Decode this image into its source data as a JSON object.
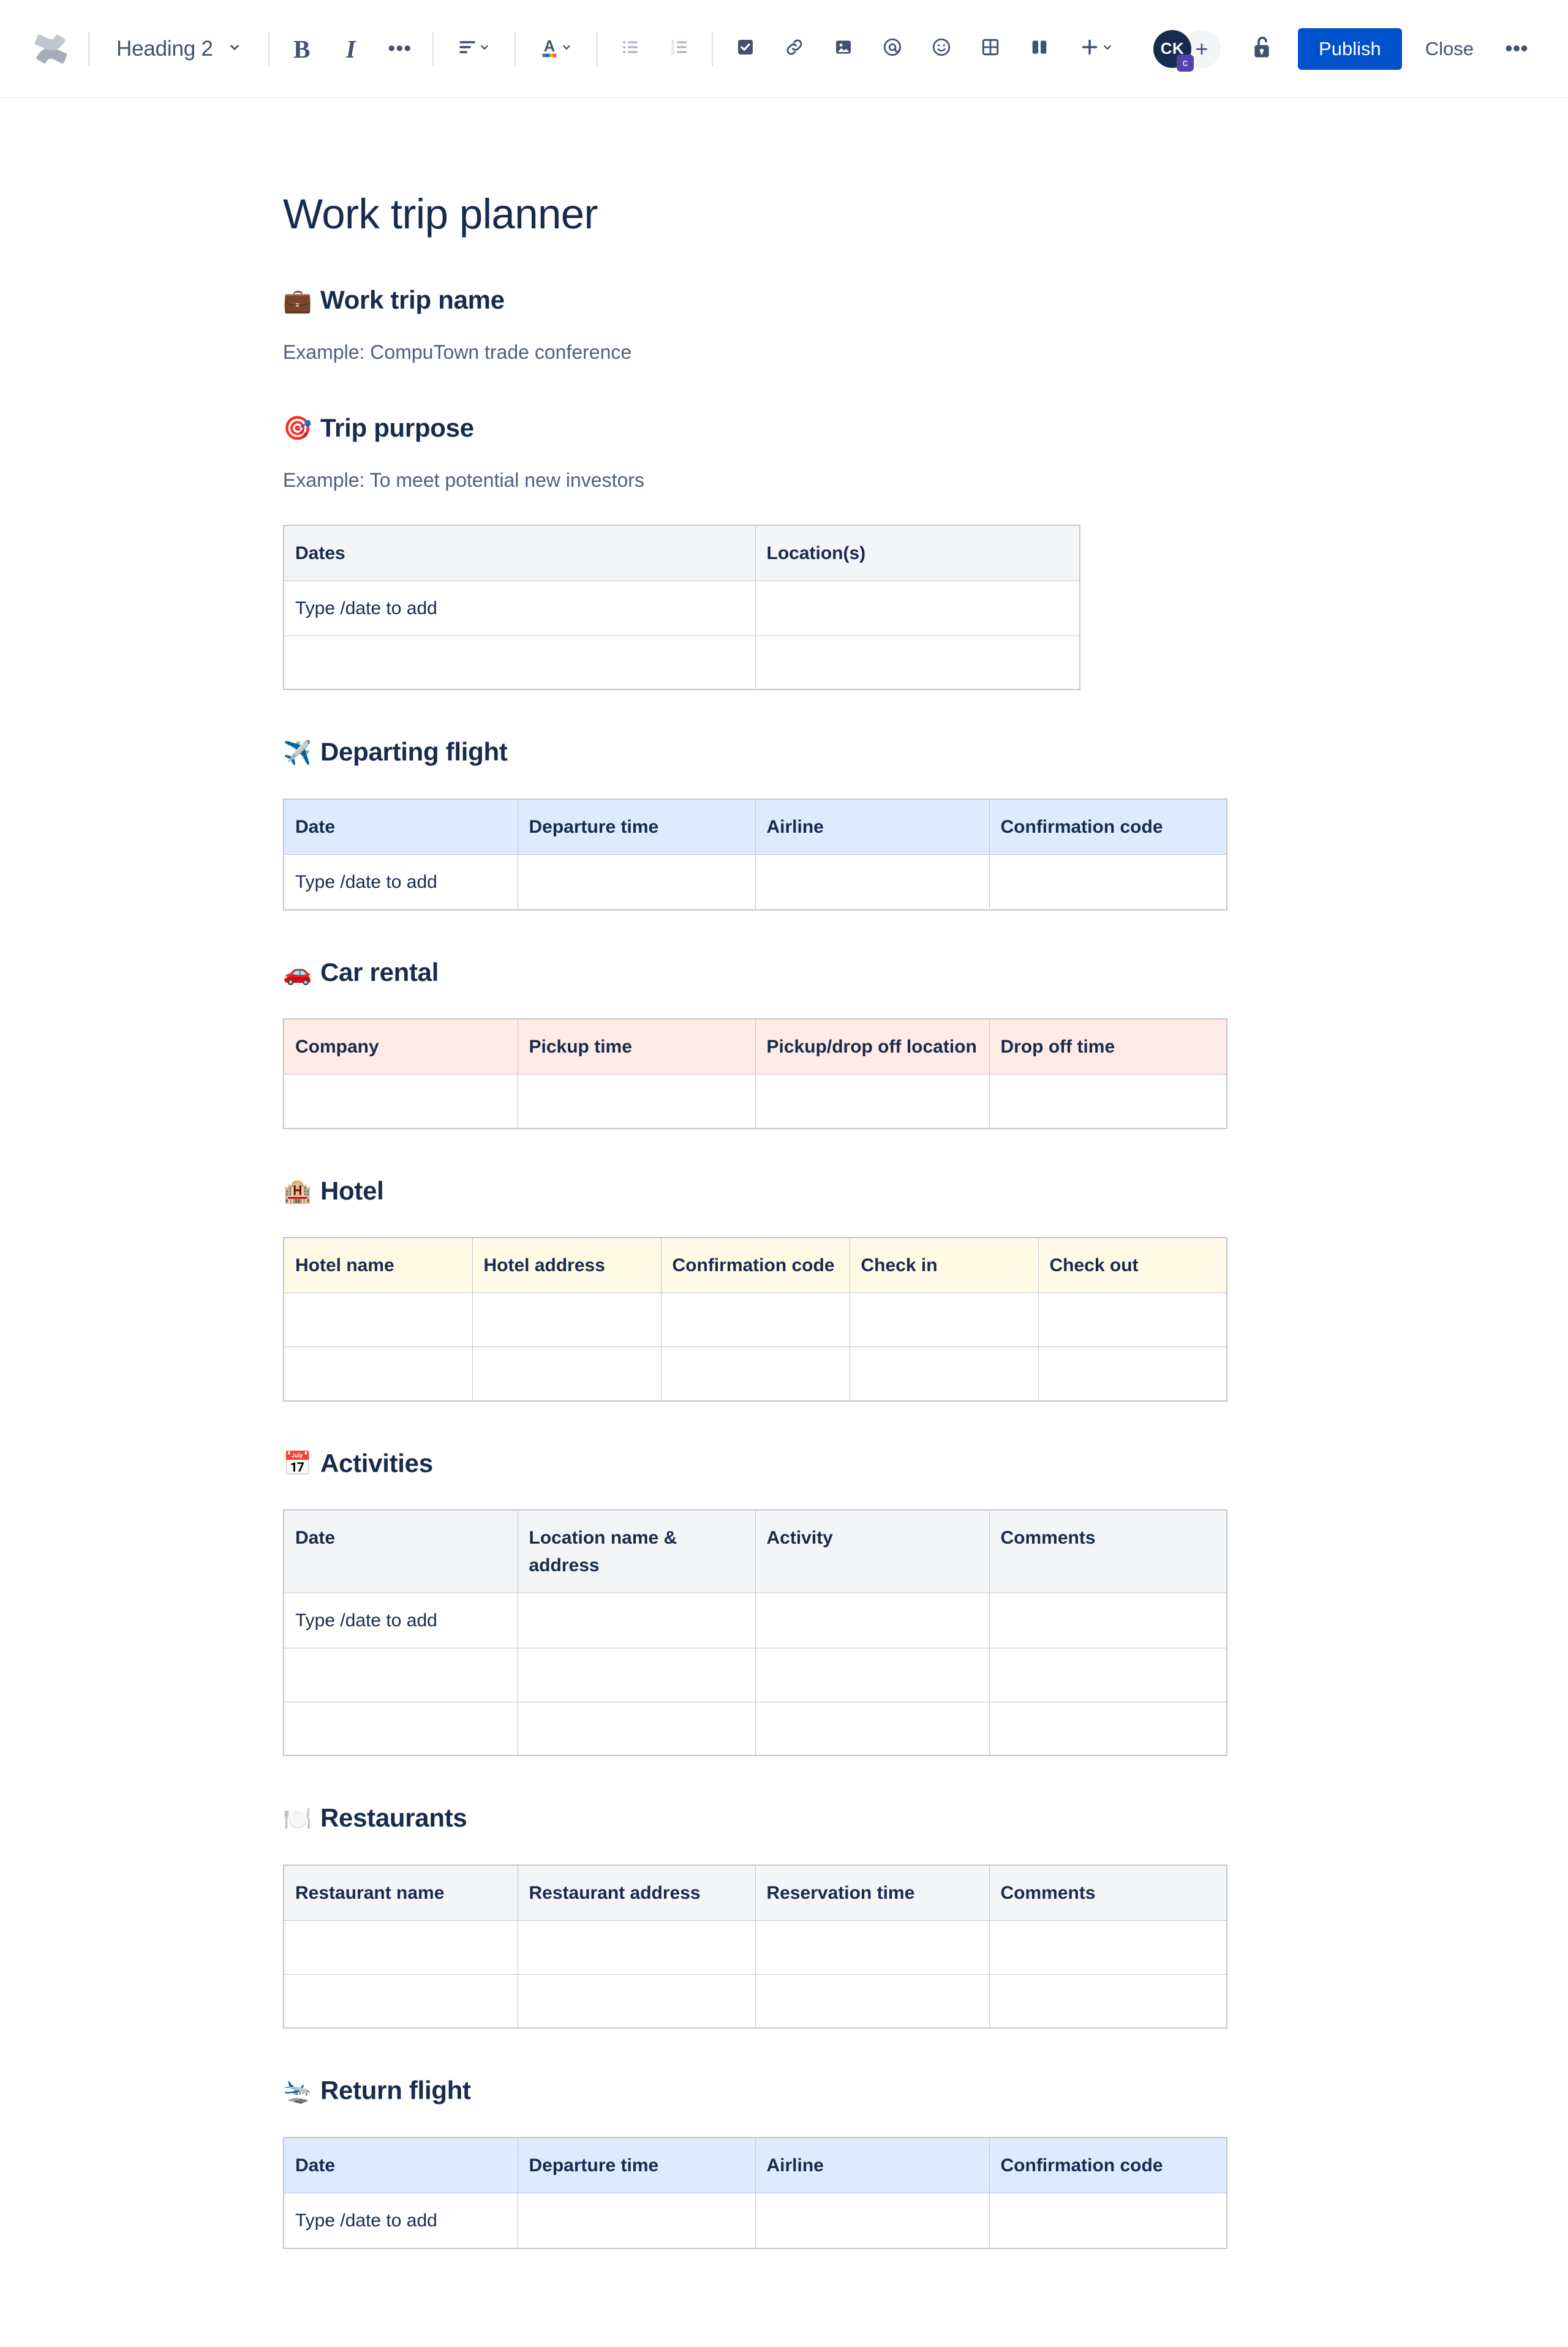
{
  "toolbar": {
    "logo_icon": "confluence-logo-icon",
    "heading_select": {
      "value": "Heading 2",
      "chevron_icon": "chevron-down-icon"
    },
    "bold_label": "B",
    "italic_label": "I",
    "more_formatting_label": "•••",
    "align_icon": "text-align-icon",
    "text_color_label": "A",
    "bullet_list_icon": "bullet-list-icon",
    "numbered_list_icon": "numbered-list-icon",
    "task_icon": "task-checkbox-icon",
    "link_icon": "link-icon",
    "image_icon": "image-icon",
    "mention_icon": "mention-at-icon",
    "emoji_icon": "emoji-smiley-icon",
    "table_icon": "table-icon",
    "layout_icon": "layout-columns-icon",
    "insert_label": "+",
    "avatar_initials": "CK",
    "avatar_badge": "c",
    "add_people_label": "+",
    "lock_icon": "unlocked-padlock-icon",
    "publish_label": "Publish",
    "close_label": "Close",
    "more_label": "•••",
    "accent_color": "#0052cc"
  },
  "page": {
    "title": "Work trip planner"
  },
  "sections": {
    "trip_name": {
      "emoji": "💼",
      "heading": "Work trip name",
      "example": "Example: CompuTown trade conference"
    },
    "trip_purpose": {
      "emoji": "🎯",
      "heading": "Trip purpose",
      "example": "Example: To meet potential new investors",
      "table": {
        "headers": [
          "Dates",
          "Location(s)"
        ],
        "rows": [
          [
            "Type /date to add",
            ""
          ],
          [
            "",
            ""
          ]
        ],
        "placeholder_cells": [
          [
            0,
            0
          ]
        ],
        "header_tint": "#f4f5f7"
      }
    },
    "departing_flight": {
      "emoji": "✈️",
      "heading": "Departing flight",
      "table": {
        "headers": [
          "Date",
          "Departure time",
          "Airline",
          "Confirmation code"
        ],
        "rows": [
          [
            "Type /date to add",
            "",
            "",
            ""
          ]
        ],
        "placeholder_cells": [
          [
            0,
            0
          ]
        ],
        "header_tint": "#deebff"
      }
    },
    "car_rental": {
      "emoji": "🚗",
      "heading": "Car rental",
      "table": {
        "headers": [
          "Company",
          "Pickup time",
          "Pickup/drop off location",
          "Drop off time"
        ],
        "rows": [
          [
            "",
            "",
            "",
            ""
          ]
        ],
        "placeholder_cells": [],
        "header_tint": "#ffebe6"
      }
    },
    "hotel": {
      "emoji": "🏨",
      "heading": "Hotel",
      "table": {
        "headers": [
          "Hotel name",
          "Hotel address",
          "Confirmation code",
          "Check in",
          "Check out"
        ],
        "rows": [
          [
            "",
            "",
            "",
            "",
            ""
          ],
          [
            "",
            "",
            "",
            "",
            ""
          ]
        ],
        "placeholder_cells": [],
        "header_tint": "#fffae6"
      }
    },
    "activities": {
      "emoji": "📅",
      "heading": "Activities",
      "table": {
        "headers": [
          "Date",
          "Location name & address",
          "Activity",
          "Comments"
        ],
        "rows": [
          [
            "Type /date to add",
            "",
            "",
            ""
          ],
          [
            "",
            "",
            "",
            ""
          ],
          [
            "",
            "",
            "",
            ""
          ]
        ],
        "placeholder_cells": [
          [
            0,
            0
          ]
        ],
        "header_tint": "#f4f5f7"
      }
    },
    "restaurants": {
      "emoji": "🍽️",
      "heading": "Restaurants",
      "table": {
        "headers": [
          "Restaurant name",
          "Restaurant address",
          "Reservation time",
          "Comments"
        ],
        "rows": [
          [
            "",
            "",
            "",
            ""
          ],
          [
            "",
            "",
            "",
            ""
          ]
        ],
        "placeholder_cells": [],
        "header_tint": "#f4f5f7"
      }
    },
    "return_flight": {
      "emoji": "🛬",
      "heading": "Return flight",
      "table": {
        "headers": [
          "Date",
          "Departure time",
          "Airline",
          "Confirmation code"
        ],
        "rows": [
          [
            "Type /date to add",
            "",
            "",
            ""
          ]
        ],
        "placeholder_cells": [
          [
            0,
            0
          ]
        ],
        "header_tint": "#deebff"
      }
    }
  }
}
